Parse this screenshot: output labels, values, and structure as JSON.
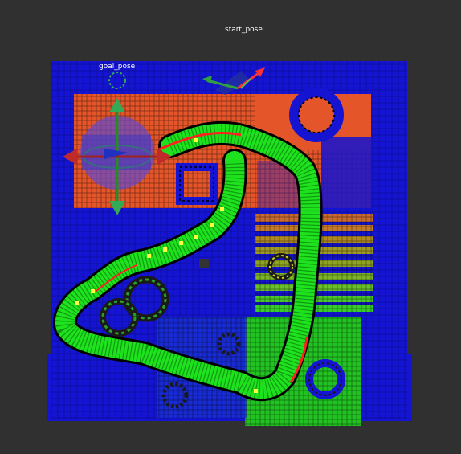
{
  "scene": {
    "start_label": "start_pose",
    "goal_label": "goal_pose"
  },
  "colors": {
    "background": "#303030",
    "free_space": "#1414d2",
    "obstacle_orange": "#e4552a",
    "obstacle_green": "#22c222",
    "obstacle_olive": "#8a8a1a",
    "path_green": "#1fe21f",
    "path_outline": "#000000",
    "path_red": "#ff2020",
    "goal_halo": "#5a4ad8",
    "start_arrow_red": "#ff3030",
    "start_arrow_green": "#30a040"
  },
  "icons": {
    "goal_marker": "pose-arrow-icon",
    "start_marker": "pose-arrow-icon"
  }
}
